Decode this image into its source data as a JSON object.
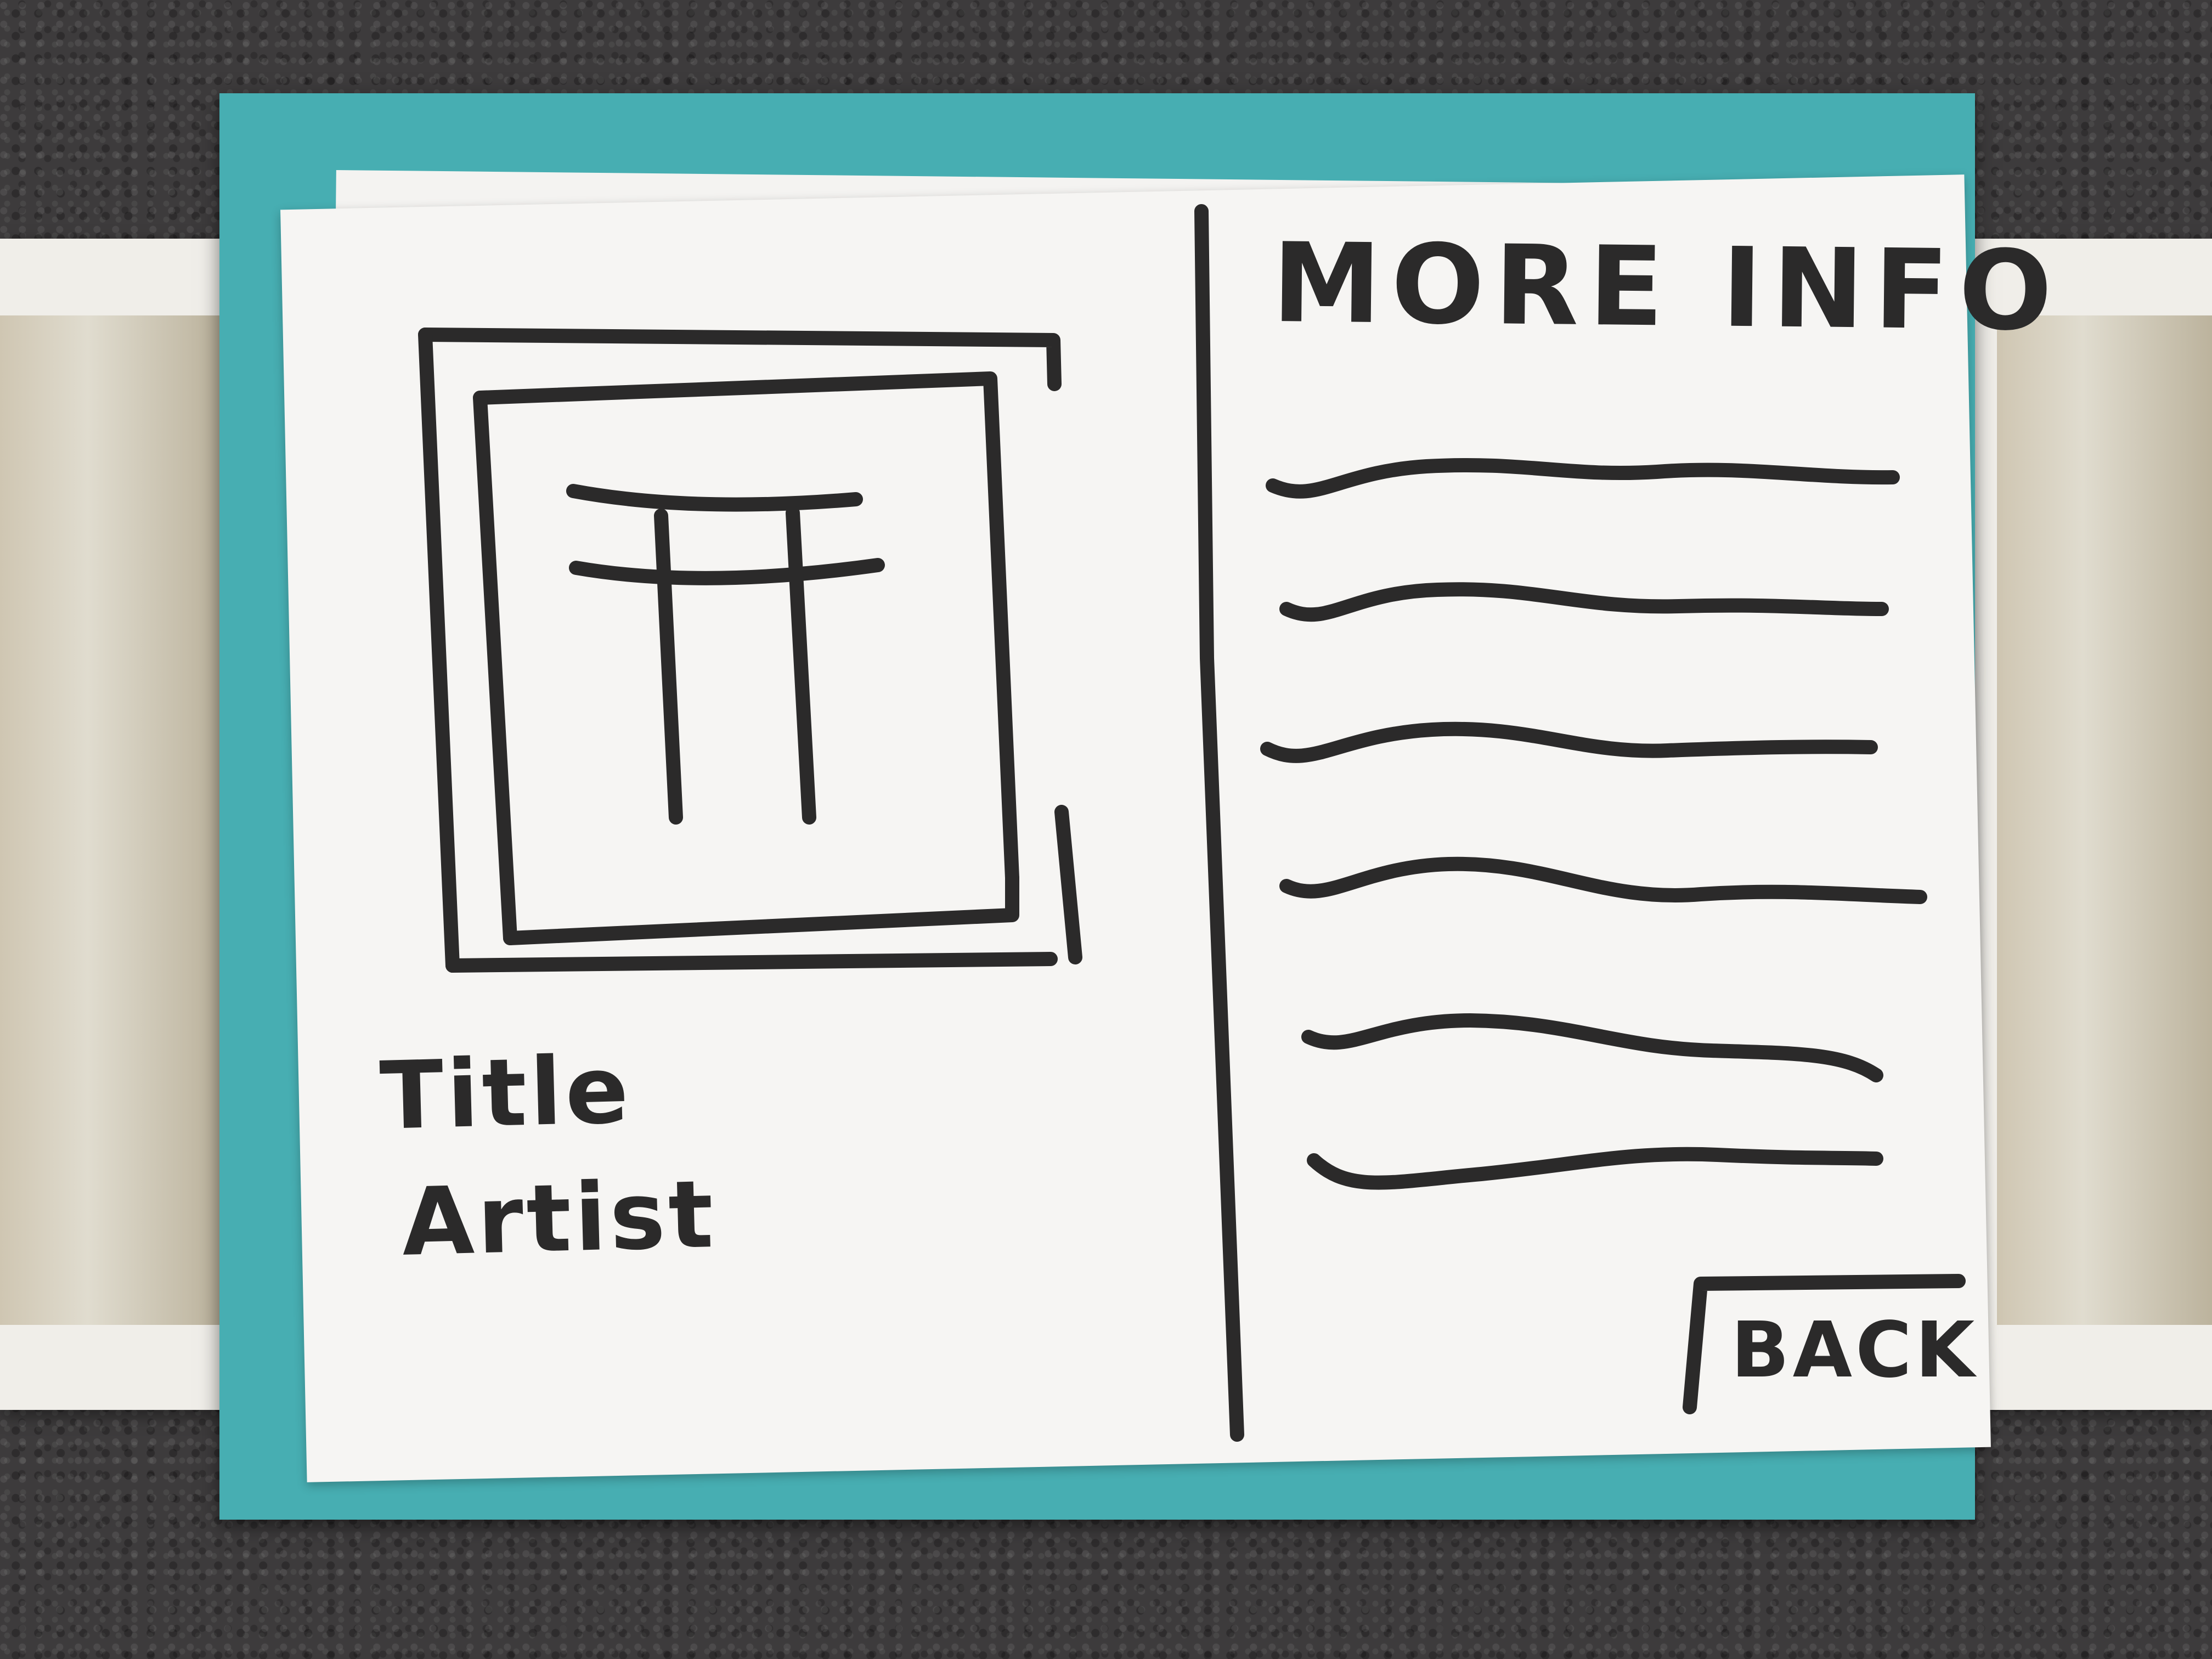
{
  "screen": {
    "heading": "MORE INFO",
    "artwork": {
      "icon": "torii-gate-icon",
      "title_label": "Title",
      "artist_label": "Artist"
    },
    "description_line_count": 6,
    "back_button_label": "BACK"
  },
  "colors": {
    "mat": "#47aeb2",
    "paper": "#f6f5f3",
    "ink": "#2b2a2a",
    "carpet": "#3d3b3c"
  }
}
